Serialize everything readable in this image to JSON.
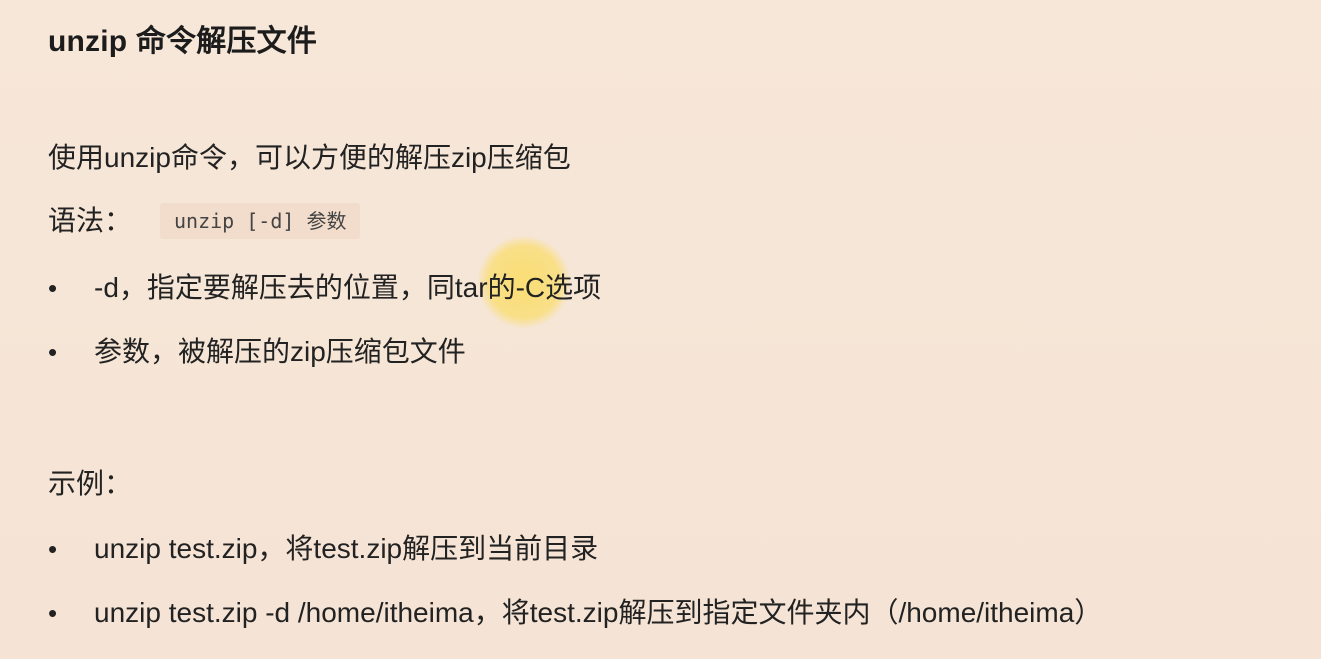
{
  "title": "unzip 命令解压文件",
  "intro": "使用unzip命令，可以方便的解压zip压缩包",
  "syntax": {
    "label": "语法：",
    "code": "unzip [-d] 参数"
  },
  "params": [
    {
      "text": "-d，指定要解压去的位置，同tar的-C选项"
    },
    {
      "text": "参数，被解压的zip压缩包文件"
    }
  ],
  "example": {
    "label": "示例：",
    "items": [
      {
        "text": "unzip test.zip，将test.zip解压到当前目录"
      },
      {
        "text": "unzip test.zip -d /home/itheima，将test.zip解压到指定文件夹内（/home/itheima）"
      }
    ]
  },
  "bullet_glyph": "•"
}
